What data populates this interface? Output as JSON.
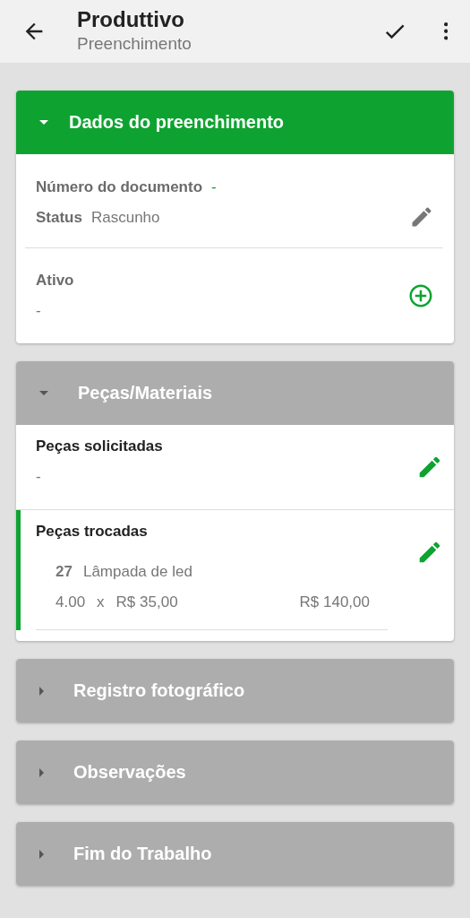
{
  "app_bar": {
    "title": "Produttivo",
    "subtitle": "Preenchimento"
  },
  "sections": [
    {
      "kind": "form",
      "title": "Dados do preenchimento",
      "expanded": true,
      "active": true,
      "rows": [
        {
          "kind": "status",
          "document_label": "Número do documento",
          "document_value": "-",
          "status_label": "Status",
          "status_value": "Rascunho"
        },
        {
          "kind": "asset",
          "label": "Ativo",
          "value": "-"
        }
      ]
    },
    {
      "kind": "parts",
      "title": "Peças/Materiais",
      "expanded": true,
      "active": false,
      "groups": [
        {
          "title": "Peças solicitadas",
          "value": "-",
          "selected": false
        },
        {
          "title": "Peças trocadas",
          "selected": true,
          "items": [
            {
              "code": "27",
              "name": "Lâmpada de led",
              "quantity": "4.00",
              "times": "x",
              "unit_price": "R$ 35,00",
              "total": "R$ 140,00"
            }
          ]
        }
      ]
    },
    {
      "kind": "collapsed",
      "title": "Registro fotográfico",
      "expanded": false,
      "active": false
    },
    {
      "kind": "collapsed",
      "title": "Observações",
      "expanded": false,
      "active": false
    },
    {
      "kind": "collapsed",
      "title": "Fim do Trabalho",
      "expanded": false,
      "active": false
    }
  ]
}
